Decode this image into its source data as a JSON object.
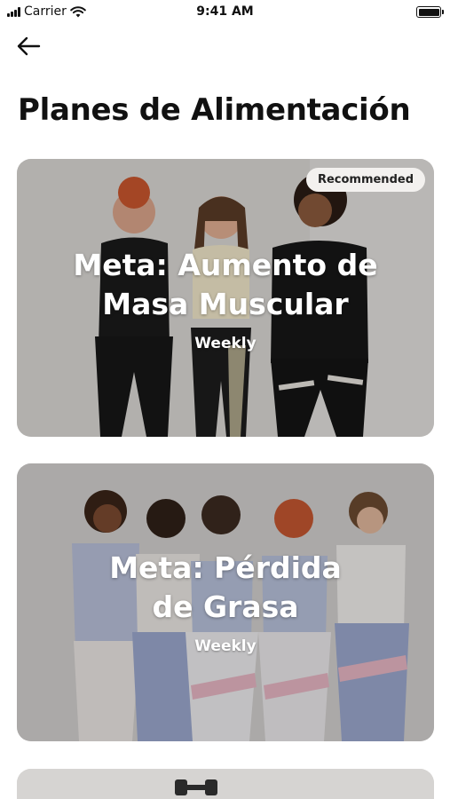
{
  "status_bar": {
    "carrier": "Carrier",
    "time": "9:41 AM"
  },
  "header": {
    "back_icon": "arrow-left-icon",
    "title": "Planes de Alimentación"
  },
  "plans": [
    {
      "title_line1": "Meta: Aumento de",
      "title_line2": "Masa Muscular",
      "frequency": "Weekly",
      "badge": "Recommended"
    },
    {
      "title_line1": "Meta: Pérdida",
      "title_line2": "de Grasa",
      "frequency": "Weekly"
    },
    {
      "illustration": "dumbbell-icon"
    }
  ],
  "colors": {
    "background": "#ffffff",
    "text": "#111111",
    "card_text": "#ffffff",
    "badge_bg": "#f3f1ef"
  }
}
